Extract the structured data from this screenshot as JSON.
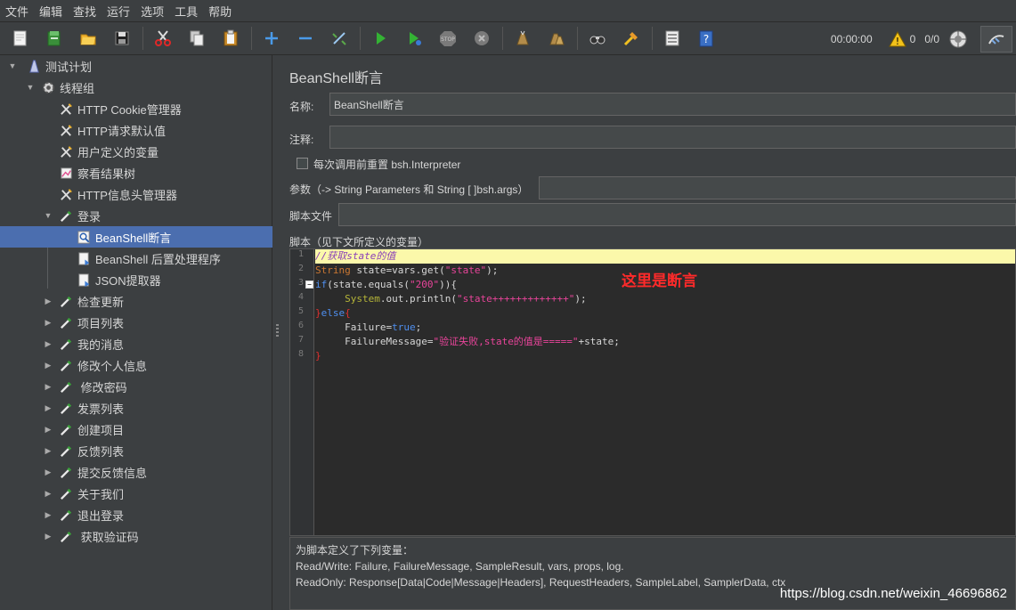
{
  "menubar": {
    "items": [
      "文件",
      "编辑",
      "查找",
      "运行",
      "选项",
      "工具",
      "帮助"
    ]
  },
  "toolbar": {
    "timer": "00:00:00",
    "warnings": "0",
    "threads": "0/0",
    "icons": [
      "new-icon",
      "templates-icon",
      "open-icon",
      "save-icon",
      "cut-icon",
      "copy-icon",
      "paste-icon",
      "expand-icon",
      "collapse-icon",
      "toggle-icon",
      "start-icon",
      "start-no-pause-icon",
      "stop-icon",
      "shutdown-icon",
      "clear-icon",
      "clear-all-icon",
      "search-icon",
      "reset-search-icon",
      "function-helper-icon",
      "help-icon",
      "warning-icon",
      "remote-icon",
      "log-icon"
    ]
  },
  "tree": {
    "items": [
      {
        "label": "测试计划",
        "level": 0,
        "expanded": true,
        "icon": "test-plan-icon"
      },
      {
        "label": "线程组",
        "level": 1,
        "expanded": true,
        "icon": "thread-group-icon"
      },
      {
        "label": "HTTP Cookie管理器",
        "level": 2,
        "icon": "config-tool-icon"
      },
      {
        "label": "HTTP请求默认值",
        "level": 2,
        "icon": "config-tool-icon"
      },
      {
        "label": "用户定义的变量",
        "level": 2,
        "icon": "config-tool-icon"
      },
      {
        "label": "察看结果树",
        "level": 2,
        "icon": "listener-icon"
      },
      {
        "label": "HTTP信息头管理器",
        "level": 2,
        "icon": "config-tool-icon"
      },
      {
        "label": "登录",
        "level": 2,
        "expanded": true,
        "icon": "sampler-icon"
      },
      {
        "label": "BeanShell断言",
        "level": 3,
        "selected": true,
        "icon": "assertion-icon"
      },
      {
        "label": "BeanShell 后置处理程序",
        "level": 3,
        "icon": "post-processor-icon"
      },
      {
        "label": "JSON提取器",
        "level": 3,
        "icon": "post-processor-icon"
      },
      {
        "label": "检查更新",
        "level": 2,
        "collapsed": true,
        "icon": "sampler-icon"
      },
      {
        "label": "项目列表",
        "level": 2,
        "collapsed": true,
        "icon": "sampler-icon"
      },
      {
        "label": "我的消息",
        "level": 2,
        "collapsed": true,
        "icon": "sampler-icon"
      },
      {
        "label": "修改个人信息",
        "level": 2,
        "collapsed": true,
        "icon": "sampler-icon"
      },
      {
        "label": " 修改密码",
        "level": 2,
        "collapsed": true,
        "icon": "sampler-icon"
      },
      {
        "label": "发票列表",
        "level": 2,
        "collapsed": true,
        "icon": "sampler-icon"
      },
      {
        "label": "创建项目",
        "level": 2,
        "collapsed": true,
        "icon": "sampler-icon"
      },
      {
        "label": "反馈列表",
        "level": 2,
        "collapsed": true,
        "icon": "sampler-icon"
      },
      {
        "label": "提交反馈信息",
        "level": 2,
        "collapsed": true,
        "icon": "sampler-icon"
      },
      {
        "label": "关于我们",
        "level": 2,
        "collapsed": true,
        "icon": "sampler-icon"
      },
      {
        "label": "退出登录",
        "level": 2,
        "collapsed": true,
        "icon": "sampler-icon"
      },
      {
        "label": " 获取验证码",
        "level": 2,
        "collapsed": true,
        "icon": "sampler-icon"
      }
    ]
  },
  "panel": {
    "title": "BeanShell断言",
    "name_label": "名称:",
    "name_value": "BeanShell断言",
    "comment_label": "注释:",
    "comment_value": "",
    "reset_label": "每次调用前重置 bsh.Interpreter",
    "reset_checked": false,
    "params_label": "参数（-> String Parameters 和 String [ ]bsh.args）",
    "params_value": "",
    "file_label": "脚本文件",
    "file_value": "",
    "script_label": "脚本（见下文所定义的变量）"
  },
  "script": {
    "lines": [
      "//获取state的值",
      "String state=vars.get(\"state\");",
      "if(state.equals(\"200\")){",
      "     System.out.println(\"state+++++++++++++\");",
      "}else{",
      "     Failure=true;",
      "     FailureMessage=\"验证失败,state的值是=====\"+state;",
      "}"
    ],
    "annotation": "这里是断言"
  },
  "info": {
    "lines": [
      "为脚本定义了下列变量：",
      "Read/Write: Failure, FailureMessage, SampleResult, vars, props, log.",
      "ReadOnly: Response[Data|Code|Message|Headers], RequestHeaders, SampleLabel, SamplerData, ctx"
    ]
  },
  "watermark": "https://blog.csdn.net/weixin_46696862"
}
